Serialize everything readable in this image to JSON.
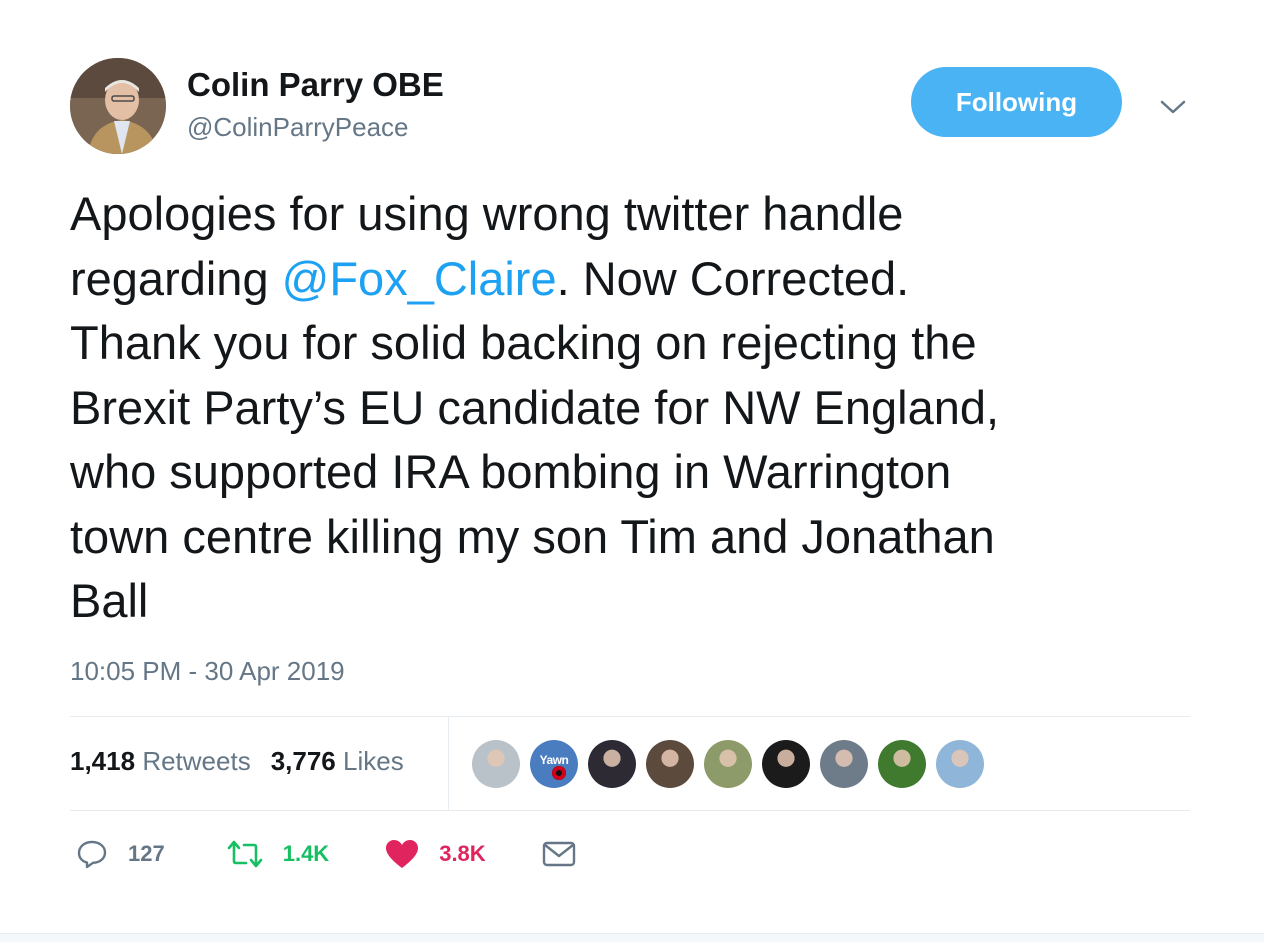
{
  "author": {
    "name": "Colin Parry OBE",
    "handle": "@ColinParryPeace"
  },
  "follow_button": {
    "label": "Following"
  },
  "more_menu": {
    "icon": "chevron-down-icon"
  },
  "tweet": {
    "text_before": "Apologies for using wrong twitter handle\nregarding ",
    "mention": "@Fox_Claire",
    "text_after": ". Now Corrected.\nThank you for solid backing on rejecting the\nBrexit Party’s  EU candidate for NW England,\nwho supported IRA bombing in Warrington\ntown centre killing my son Tim and Jonathan\nBall",
    "timestamp": "10:05 PM - 30 Apr 2019"
  },
  "stats": {
    "retweets_count": "1,418",
    "retweets_label": "Retweets",
    "likes_count": "3,776",
    "likes_label": "Likes"
  },
  "likers": [
    {
      "icon": "user-avatar",
      "color": "#b9c2c8"
    },
    {
      "icon": "yawn-logo-avatar",
      "color": "#4a7cc0",
      "text": "Yawn"
    },
    {
      "icon": "user-avatar",
      "color": "#2d2a33"
    },
    {
      "icon": "user-avatar",
      "color": "#5c4a3c"
    },
    {
      "icon": "user-avatar",
      "color": "#8d9a6a"
    },
    {
      "icon": "user-avatar",
      "color": "#1b1b1b"
    },
    {
      "icon": "user-avatar",
      "color": "#6e7c8a"
    },
    {
      "icon": "user-avatar",
      "color": "#3f7a2e"
    },
    {
      "icon": "user-avatar",
      "color": "#8fb5d8"
    }
  ],
  "actions": {
    "reply_count": "127",
    "retweet_count": "1.4K",
    "like_count": "3.8K"
  },
  "colors": {
    "accent": "#4ab3f4",
    "mention": "#1da1f2",
    "retweet": "#17bf63",
    "like": "#e0245e",
    "muted": "#657786"
  }
}
